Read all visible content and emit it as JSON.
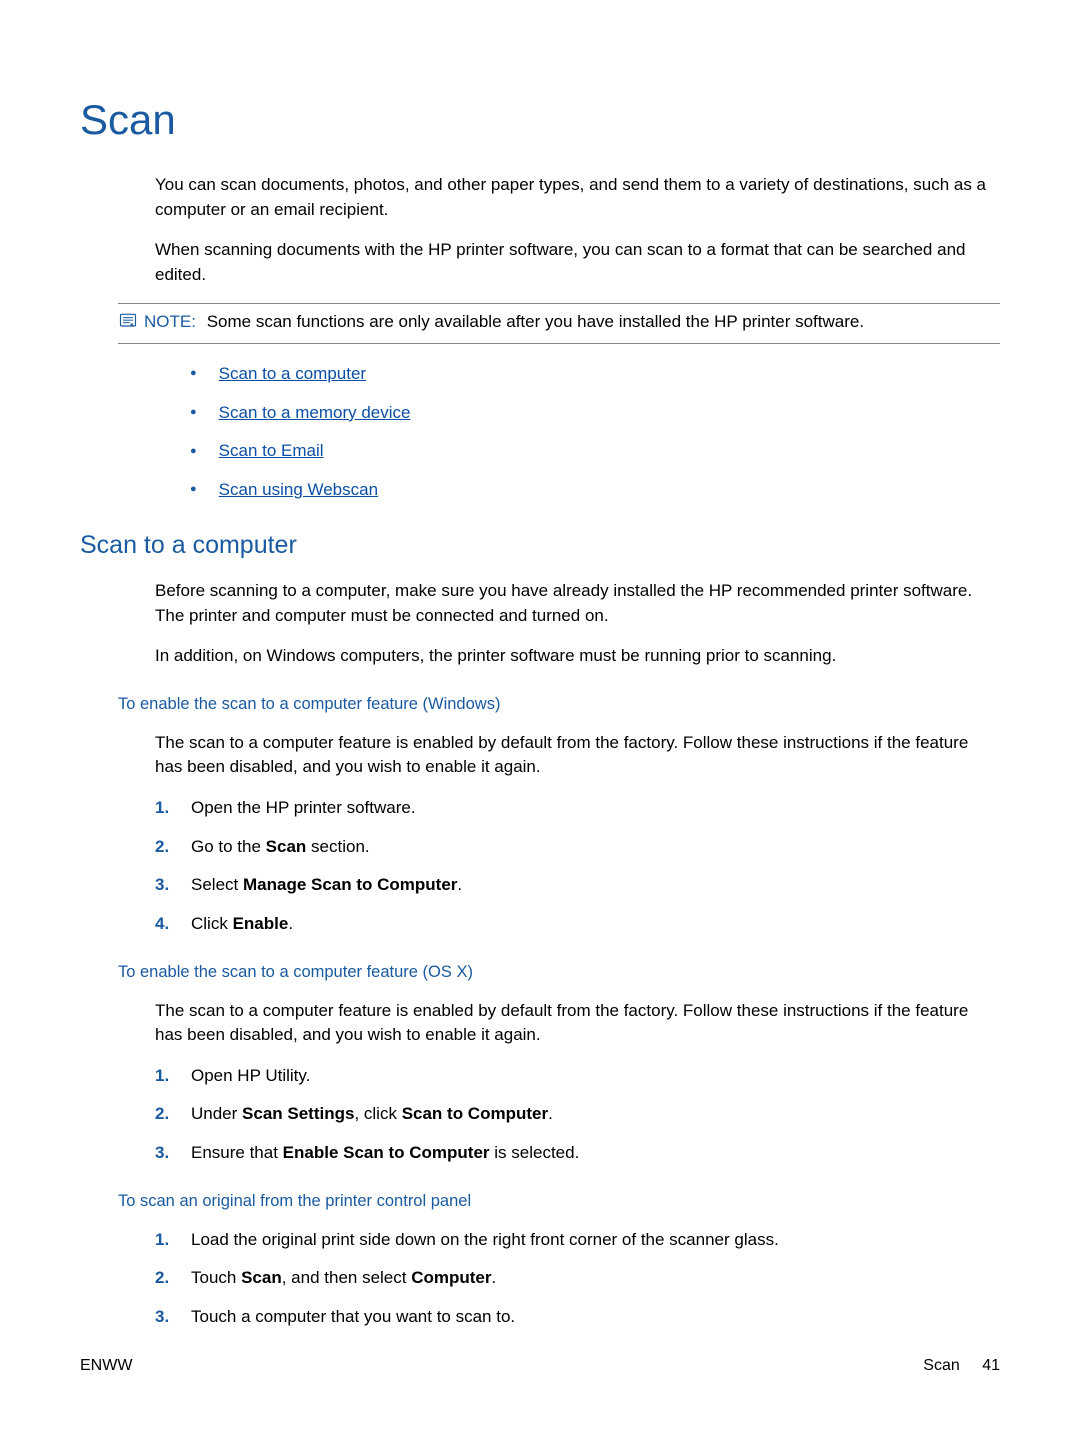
{
  "title": "Scan",
  "intro_p1": "You can scan documents, photos, and other paper types, and send them to a variety of destinations, such as a computer or an email recipient.",
  "intro_p2": "When scanning documents with the HP printer software, you can scan to a format that can be searched and edited.",
  "note": {
    "label": "NOTE:",
    "text": "Some scan functions are only available after you have installed the HP printer software."
  },
  "toc": [
    "Scan to a computer",
    "Scan to a memory device",
    "Scan to Email",
    "Scan using Webscan"
  ],
  "section_h2": "Scan to a computer",
  "s2_p1": "Before scanning to a computer, make sure you have already installed the HP recommended printer software. The printer and computer must be connected and turned on.",
  "s2_p2": "In addition, on Windows computers, the printer software must be running prior to scanning.",
  "h3_windows": "To enable the scan to a computer feature (Windows)",
  "win_intro": "The scan to a computer feature is enabled by default from the factory. Follow these instructions if the feature has been disabled, and you wish to enable it again.",
  "win_steps": {
    "s1": "Open the HP printer software.",
    "s2_a": "Go to the ",
    "s2_b": "Scan",
    "s2_c": " section.",
    "s3_a": "Select ",
    "s3_b": "Manage Scan to Computer",
    "s3_c": ".",
    "s4_a": "Click ",
    "s4_b": "Enable",
    "s4_c": "."
  },
  "h3_osx": "To enable the scan to a computer feature (OS X)",
  "osx_intro": "The scan to a computer feature is enabled by default from the factory. Follow these instructions if the feature has been disabled, and you wish to enable it again.",
  "osx_steps": {
    "s1": "Open HP Utility.",
    "s2_a": "Under ",
    "s2_b": "Scan Settings",
    "s2_c": ", click ",
    "s2_d": "Scan to Computer",
    "s2_e": ".",
    "s3_a": "Ensure that ",
    "s3_b": "Enable Scan to Computer",
    "s3_c": " is selected."
  },
  "h3_panel": "To scan an original from the printer control panel",
  "panel_steps": {
    "s1": "Load the original print side down on the right front corner of the scanner glass.",
    "s2_a": "Touch ",
    "s2_b": "Scan",
    "s2_c": ", and then select ",
    "s2_d": "Computer",
    "s2_e": ".",
    "s3": "Touch a computer that you want to scan to."
  },
  "footer": {
    "left": "ENWW",
    "right_label": "Scan",
    "page": "41"
  }
}
